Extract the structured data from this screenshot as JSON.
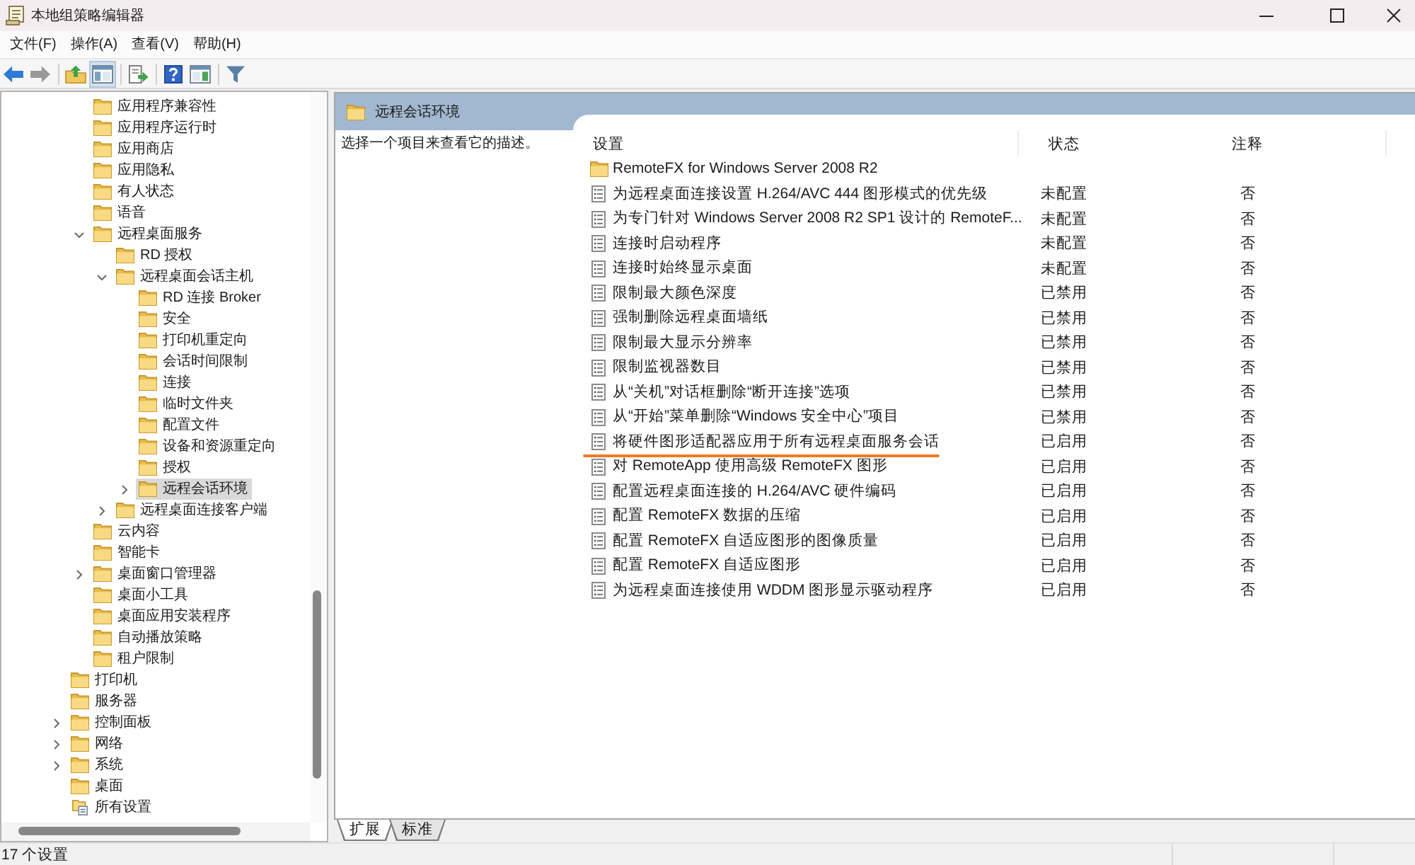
{
  "window": {
    "title": "本地组策略编辑器"
  },
  "menu": [
    "文件(F)",
    "操作(A)",
    "查看(V)",
    "帮助(H)"
  ],
  "toolbar": [
    {
      "buttons": [
        {
          "kind": "back",
          "disabled": false,
          "pressed": false
        },
        {
          "kind": "forward",
          "disabled": true,
          "pressed": false
        }
      ]
    },
    {
      "buttons": [
        {
          "kind": "up",
          "disabled": false,
          "pressed": false
        },
        {
          "kind": "tree",
          "disabled": false,
          "pressed": true
        }
      ]
    },
    {
      "buttons": [
        {
          "kind": "export",
          "disabled": false,
          "pressed": false
        }
      ]
    },
    {
      "buttons": [
        {
          "kind": "help",
          "disabled": false,
          "pressed": false
        },
        {
          "kind": "pane",
          "disabled": false,
          "pressed": false
        }
      ]
    },
    {
      "buttons": [
        {
          "kind": "filter",
          "disabled": false,
          "pressed": false
        }
      ]
    }
  ],
  "tree": {
    "scrolled_branch": {
      "children": [
        {
          "label": "应用程序兼容性",
          "kind": "folder",
          "expandable": false,
          "expanded": false,
          "selected": false
        },
        {
          "label": "应用程序运行时",
          "kind": "folder",
          "expandable": false,
          "expanded": false,
          "selected": false
        },
        {
          "label": "应用商店",
          "kind": "folder",
          "expandable": false,
          "expanded": false,
          "selected": false
        },
        {
          "label": "应用隐私",
          "kind": "folder",
          "expandable": false,
          "expanded": false,
          "selected": false
        },
        {
          "label": "有人状态",
          "kind": "folder",
          "expandable": false,
          "expanded": false,
          "selected": false
        },
        {
          "label": "语音",
          "kind": "folder",
          "expandable": false,
          "expanded": false,
          "selected": false
        },
        {
          "label": "远程桌面服务",
          "kind": "folder",
          "expandable": true,
          "expanded": true,
          "selected": false,
          "children": [
            {
              "label": "RD 授权",
              "kind": "folder",
              "expandable": false,
              "expanded": false,
              "selected": false
            },
            {
              "label": "远程桌面会话主机",
              "kind": "folder",
              "expandable": true,
              "expanded": true,
              "selected": false,
              "children": [
                {
                  "label": "RD 连接 Broker",
                  "kind": "folder",
                  "expandable": false,
                  "expanded": false,
                  "selected": false
                },
                {
                  "label": "安全",
                  "kind": "folder",
                  "expandable": false,
                  "expanded": false,
                  "selected": false
                },
                {
                  "label": "打印机重定向",
                  "kind": "folder",
                  "expandable": false,
                  "expanded": false,
                  "selected": false
                },
                {
                  "label": "会话时间限制",
                  "kind": "folder",
                  "expandable": false,
                  "expanded": false,
                  "selected": false
                },
                {
                  "label": "连接",
                  "kind": "folder",
                  "expandable": false,
                  "expanded": false,
                  "selected": false
                },
                {
                  "label": "临时文件夹",
                  "kind": "folder",
                  "expandable": false,
                  "expanded": false,
                  "selected": false
                },
                {
                  "label": "配置文件",
                  "kind": "folder",
                  "expandable": false,
                  "expanded": false,
                  "selected": false
                },
                {
                  "label": "设备和资源重定向",
                  "kind": "folder",
                  "expandable": false,
                  "expanded": false,
                  "selected": false
                },
                {
                  "label": "授权",
                  "kind": "folder",
                  "expandable": false,
                  "expanded": false,
                  "selected": false
                },
                {
                  "label": "远程会话环境",
                  "kind": "folder",
                  "expandable": true,
                  "expanded": false,
                  "selected": true
                }
              ]
            },
            {
              "label": "远程桌面连接客户端",
              "kind": "folder",
              "expandable": true,
              "expanded": false,
              "selected": false
            }
          ]
        },
        {
          "label": "云内容",
          "kind": "folder",
          "expandable": false,
          "expanded": false,
          "selected": false
        },
        {
          "label": "智能卡",
          "kind": "folder",
          "expandable": false,
          "expanded": false,
          "selected": false
        },
        {
          "label": "桌面窗口管理器",
          "kind": "folder",
          "expandable": true,
          "expanded": false,
          "selected": false
        },
        {
          "label": "桌面小工具",
          "kind": "folder",
          "expandable": false,
          "expanded": false,
          "selected": false
        },
        {
          "label": "桌面应用安装程序",
          "kind": "folder",
          "expandable": false,
          "expanded": false,
          "selected": false
        },
        {
          "label": "自动播放策略",
          "kind": "folder",
          "expandable": false,
          "expanded": false,
          "selected": false
        },
        {
          "label": "租户限制",
          "kind": "folder",
          "expandable": false,
          "expanded": false,
          "selected": false
        }
      ]
    },
    "items": [
      {
        "label": "打印机",
        "kind": "folder",
        "expandable": false,
        "expanded": false,
        "selected": false
      },
      {
        "label": "服务器",
        "kind": "folder",
        "expandable": false,
        "expanded": false,
        "selected": false
      },
      {
        "label": "控制面板",
        "kind": "folder",
        "expandable": true,
        "expanded": false,
        "selected": false
      },
      {
        "label": "网络",
        "kind": "folder",
        "expandable": true,
        "expanded": false,
        "selected": false
      },
      {
        "label": "系统",
        "kind": "folder",
        "expandable": true,
        "expanded": false,
        "selected": false
      },
      {
        "label": "桌面",
        "kind": "folder",
        "expandable": false,
        "expanded": false,
        "selected": false
      },
      {
        "label": "所有设置",
        "kind": "settings",
        "expandable": false,
        "expanded": false,
        "selected": false
      }
    ]
  },
  "details": {
    "title": "远程会话环境",
    "description": "选择一个项目来查看它的描述。",
    "columns": [
      "设置",
      "状态",
      "注释"
    ],
    "rows": [
      {
        "kind": "folder",
        "name": "RemoteFX for Windows Server 2008 R2",
        "underlined": false
      },
      {
        "kind": "setting",
        "name": "为远程桌面连接设置 H.264/AVC 444 图形模式的优先级",
        "state": "未配置",
        "comment": "否",
        "underlined": false
      },
      {
        "kind": "setting",
        "name": "为专门针对 Windows Server 2008 R2 SP1 设计的 RemoteF...",
        "state": "未配置",
        "comment": "否",
        "underlined": false
      },
      {
        "kind": "setting",
        "name": "连接时启动程序",
        "state": "未配置",
        "comment": "否",
        "underlined": false
      },
      {
        "kind": "setting",
        "name": "连接时始终显示桌面",
        "state": "未配置",
        "comment": "否",
        "underlined": false
      },
      {
        "kind": "setting",
        "name": "限制最大颜色深度",
        "state": "已禁用",
        "comment": "否",
        "underlined": false
      },
      {
        "kind": "setting",
        "name": "强制删除远程桌面墙纸",
        "state": "已禁用",
        "comment": "否",
        "underlined": false
      },
      {
        "kind": "setting",
        "name": "限制最大显示分辨率",
        "state": "已禁用",
        "comment": "否",
        "underlined": false
      },
      {
        "kind": "setting",
        "name": "限制监视器数目",
        "state": "已禁用",
        "comment": "否",
        "underlined": false
      },
      {
        "kind": "setting",
        "name": "从“关机”对话框删除“断开连接”选项",
        "state": "已禁用",
        "comment": "否",
        "underlined": false
      },
      {
        "kind": "setting",
        "name": "从“开始”菜单删除“Windows 安全中心”项目",
        "state": "已禁用",
        "comment": "否",
        "underlined": false
      },
      {
        "kind": "setting",
        "name": "将硬件图形适配器应用于所有远程桌面服务会话",
        "state": "已启用",
        "comment": "否",
        "underlined": true
      },
      {
        "kind": "setting",
        "name": "对 RemoteApp 使用高级 RemoteFX 图形",
        "state": "已启用",
        "comment": "否",
        "underlined": false
      },
      {
        "kind": "setting",
        "name": "配置远程桌面连接的 H.264/AVC 硬件编码",
        "state": "已启用",
        "comment": "否",
        "underlined": false
      },
      {
        "kind": "setting",
        "name": "配置 RemoteFX 数据的压缩",
        "state": "已启用",
        "comment": "否",
        "underlined": false
      },
      {
        "kind": "setting",
        "name": "配置 RemoteFX 自适应图形的图像质量",
        "state": "已启用",
        "comment": "否",
        "underlined": false
      },
      {
        "kind": "setting",
        "name": "配置 RemoteFX 自适应图形",
        "state": "已启用",
        "comment": "否",
        "underlined": false
      },
      {
        "kind": "setting",
        "name": "为远程桌面连接使用 WDDM 图形显示驱动程序",
        "state": "已启用",
        "comment": "否",
        "underlined": false
      }
    ]
  },
  "view_tabs": [
    {
      "label": "扩展",
      "selected": true
    },
    {
      "label": "标准",
      "selected": false
    }
  ],
  "status_bar": {
    "text": "17 个设置"
  }
}
